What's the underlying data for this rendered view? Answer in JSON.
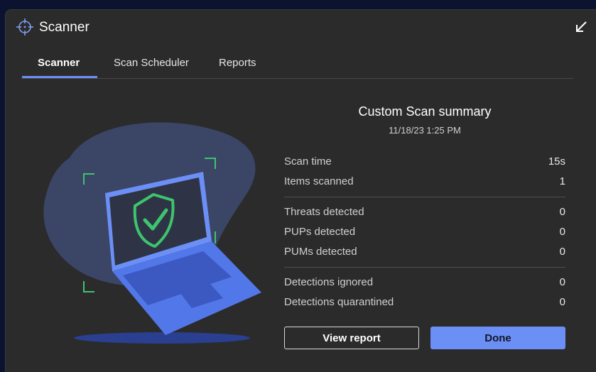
{
  "window": {
    "title": "Scanner"
  },
  "icons": {
    "title": "crosshair-icon",
    "minimize": "arrow-down-left-icon",
    "illustration": "shield-check-icon"
  },
  "tabs": [
    {
      "label": "Scanner",
      "active": true
    },
    {
      "label": "Scan Scheduler",
      "active": false
    },
    {
      "label": "Reports",
      "active": false
    }
  ],
  "summary": {
    "title": "Custom Scan summary",
    "date": "11/18/23 1:25 PM",
    "rows": [
      {
        "label": "Scan time",
        "value": "15s"
      },
      {
        "label": "Items scanned",
        "value": "1"
      },
      {
        "label": "Threats detected",
        "value": "0"
      },
      {
        "label": "PUPs detected",
        "value": "0"
      },
      {
        "label": "PUMs detected",
        "value": "0"
      },
      {
        "label": "Detections ignored",
        "value": "0"
      },
      {
        "label": "Detections quarantined",
        "value": "0"
      }
    ]
  },
  "buttons": {
    "view_report": "View report",
    "done": "Done"
  },
  "colors": {
    "accent": "#6b8ff5",
    "background": "#2b2b2b",
    "shield": "#3ec46d",
    "desktop": "#0b1330"
  }
}
